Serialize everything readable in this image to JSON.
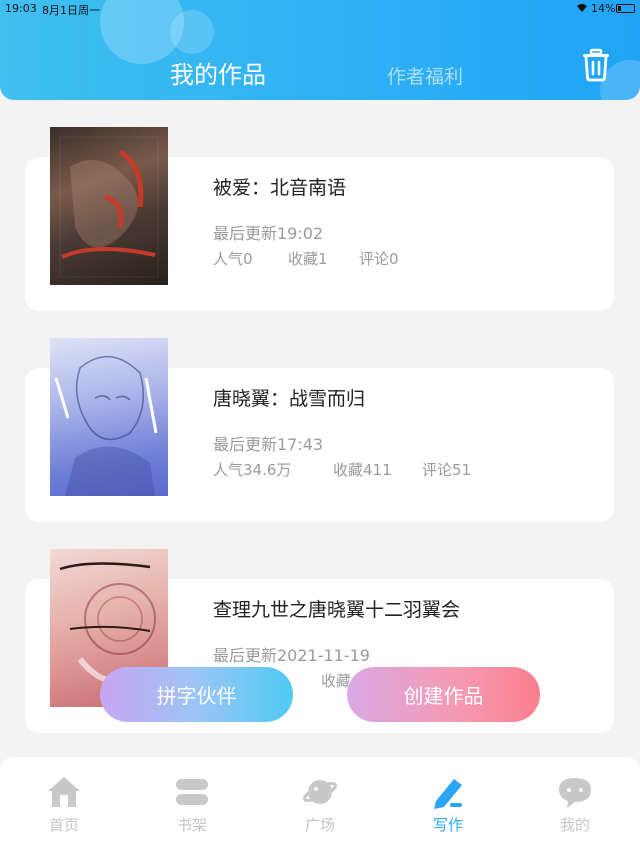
{
  "status_bar": {
    "time": "19:03",
    "date": "8月1日周一",
    "battery": "14%"
  },
  "header": {
    "tab_active": "我的作品",
    "tab_inactive": "作者福利"
  },
  "works": [
    {
      "title": "被爱：北音南语",
      "updated": "最后更新19:02",
      "popularity": "人气0",
      "favorites": "收藏1",
      "comments": "评论0"
    },
    {
      "title": "唐晓翼：战雪而归",
      "updated": "最后更新17:43",
      "popularity": "人气34.6万",
      "favorites": "收藏411",
      "comments": "评论51"
    },
    {
      "title": "查理九世之唐晓翼十二羽翼会",
      "updated": "最后更新2021-11-19",
      "popularity": "",
      "favorites": "收藏",
      "comments": ""
    }
  ],
  "buttons": {
    "partner": "拼字伙伴",
    "create": "创建作品"
  },
  "nav": [
    {
      "label": "首页",
      "icon": "home-icon"
    },
    {
      "label": "书架",
      "icon": "bookshelf-icon"
    },
    {
      "label": "广场",
      "icon": "planet-icon"
    },
    {
      "label": "写作",
      "icon": "pen-icon",
      "active": true
    },
    {
      "label": "我的",
      "icon": "chat-bubble-icon"
    }
  ],
  "colors": {
    "header": "#2fb0f5",
    "active_nav": "#2aa6f5",
    "inactive_nav": "#c5c5c5"
  }
}
